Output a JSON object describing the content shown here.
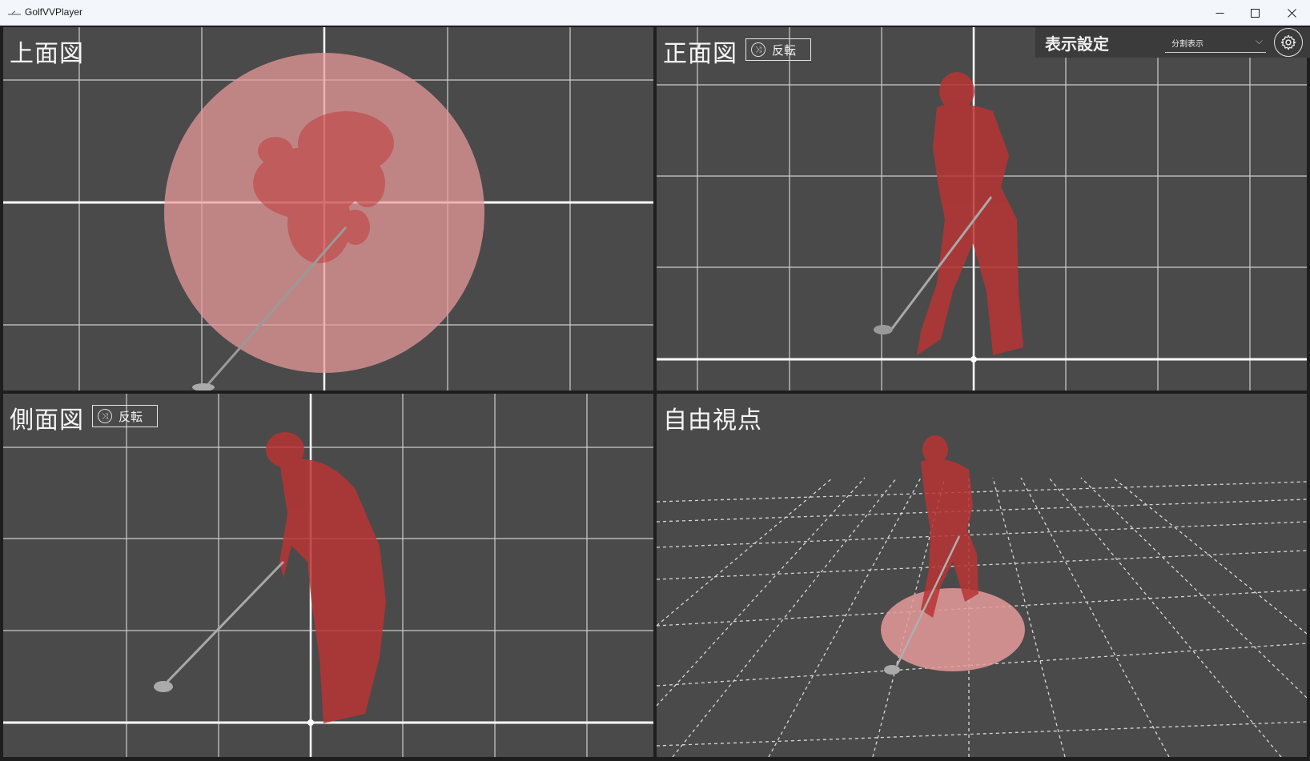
{
  "window": {
    "title": "GolfVVPlayer"
  },
  "viewports": {
    "top": {
      "label": "上面図"
    },
    "front": {
      "label": "正面図",
      "flip_label": "反転"
    },
    "side": {
      "label": "側面図",
      "flip_label": "反転"
    },
    "free": {
      "label": "自由視点"
    }
  },
  "settings": {
    "title": "表示設定",
    "display_mode": "分割表示"
  },
  "colors": {
    "viewport_bg": "#4a4a4a",
    "grid": "#e8e8e8",
    "figure": "#b83a3a",
    "balance_circle": "#e59a9a"
  },
  "icons": {
    "flip": "shuffle-icon",
    "settings": "gear-icon",
    "dropdown": "chevron-down-icon"
  }
}
